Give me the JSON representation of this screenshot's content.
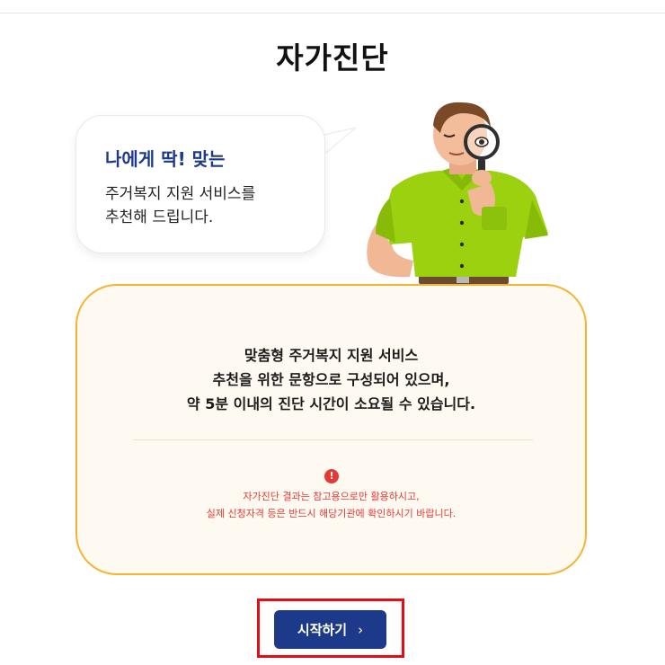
{
  "page": {
    "title": "자가진단"
  },
  "speech_bubble": {
    "heading": "나에게 딱! 맞는",
    "lines": [
      "주거복지 지원 서비스를",
      "추천해 드립니다."
    ]
  },
  "illustration": {
    "icon": "man-with-magnifying-glass-illustration"
  },
  "info_box": {
    "main_lines": [
      "맞춤형 주거복지 지원 서비스",
      "추천을 위한 문항으로 구성되어 있으며,",
      "약 5분 이내의 진단 시간이 소요될 수 있습니다."
    ],
    "warning_icon": "!",
    "note_lines": [
      "자가진단 결과는 참고용으로만 활용하시고,",
      "실제 신청자격 등은 반드시 해당기관에 확인하시기 바랍니다."
    ]
  },
  "start_button": {
    "label": "시작하기",
    "icon": "›"
  },
  "colors": {
    "brand_navy": "#1d3a8a",
    "box_border": "#f6b42e",
    "box_background": "#fffaf1",
    "warning_red": "#e53935",
    "highlight_red": "#e30d15",
    "shirt_green": "#9bd10f"
  }
}
